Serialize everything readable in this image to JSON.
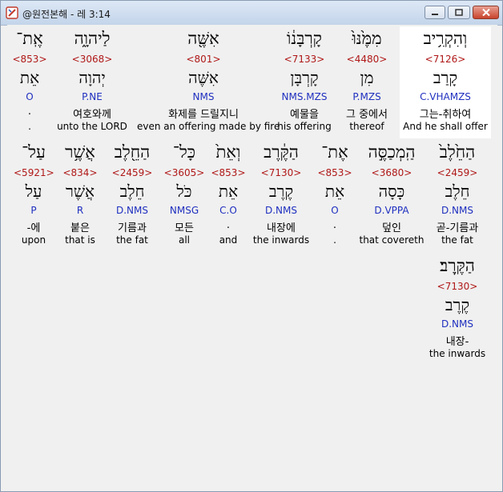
{
  "window": {
    "title": "@원전본해 - 레 3:14",
    "colors": {
      "hebrew": "#000000",
      "strongs": "#b01818",
      "morph": "#1f2fbf",
      "highlight": "#ffffff"
    }
  },
  "lines": [
    {
      "words": [
        {
          "heb": "וְהִקְרִ֥יב",
          "num": "<7126>",
          "lex": "קָרַב",
          "morph": "C.VHAMZS",
          "kor": "그는-취하여",
          "eng": "And he shall offer",
          "highlight": true
        },
        {
          "heb": "מִמֶּ֙נּוּ֙",
          "num": "<4480>",
          "lex": "מִן",
          "morph": "P.MZS",
          "kor": "그 중에서",
          "eng": "thereof"
        },
        {
          "heb": "קָרְבָּנ֔וֹ",
          "num": "<7133>",
          "lex": "קָרְבָּן",
          "morph": "NMS.MZS",
          "kor": "예물을",
          "eng": "his offering"
        },
        {
          "heb": "אִשֶּׁ֖ה",
          "num": "<801>",
          "lex": "אִשֶּׁה",
          "morph": "NMS",
          "kor": "화제를 드릴지니",
          "eng": "even an offering made by fire"
        },
        {
          "heb": "לַיהוָ֑ה",
          "num": "<3068>",
          "lex": "יְהוָה",
          "morph": "P.NE",
          "kor": "여호와께",
          "eng": "unto the LORD"
        },
        {
          "heb": "אֶֽת־",
          "num": "<853>",
          "lex": "אֵת",
          "morph": "O",
          "kor": ".",
          "eng": "."
        }
      ]
    },
    {
      "words": [
        {
          "heb": "הַחֵ֙לֶב֙",
          "num": "<2459>",
          "lex": "חֵלֶב",
          "morph": "D.NMS",
          "kor": "곧-기름과",
          "eng": "the fat"
        },
        {
          "heb": "הַֽמְכַסֶּ֣ה",
          "num": "<3680>",
          "lex": "כָּסָה",
          "morph": "D.VPPA",
          "kor": "덮인",
          "eng": "that covereth"
        },
        {
          "heb": "אֶת־",
          "num": "<853>",
          "lex": "אֵת",
          "morph": "O",
          "kor": ".",
          "eng": "."
        },
        {
          "heb": "הַקֶּ֔רֶב",
          "num": "<7130>",
          "lex": "קֶרֶב",
          "morph": "D.NMS",
          "kor": "내장에",
          "eng": "the inwards"
        },
        {
          "heb": "וְאֵת֙",
          "num": "<853>",
          "lex": "אֵת",
          "morph": "C.O",
          "kor": ".",
          "eng": "and"
        },
        {
          "heb": "כָּל־",
          "num": "<3605>",
          "lex": "כֹּל",
          "morph": "NMSG",
          "kor": "모든",
          "eng": "all"
        },
        {
          "heb": "הַחֵ֖לֶב",
          "num": "<2459>",
          "lex": "חֵלֶב",
          "morph": "D.NMS",
          "kor": "기름과",
          "eng": "the fat"
        },
        {
          "heb": "אֲשֶׁ֥ר",
          "num": "<834>",
          "lex": "אֲשֶׁר",
          "morph": "R",
          "kor": "붙은",
          "eng": "that is"
        },
        {
          "heb": "עַל־",
          "num": "<5921>",
          "lex": "עַל",
          "morph": "P",
          "kor": "-에",
          "eng": "upon"
        }
      ]
    },
    {
      "words": [
        {
          "heb": "הַקֶּֽרֶב׃",
          "num": "<7130>",
          "lex": "קֶרֶב",
          "morph": "D.NMS",
          "kor": "내장-",
          "eng": "the inwards"
        }
      ]
    }
  ]
}
